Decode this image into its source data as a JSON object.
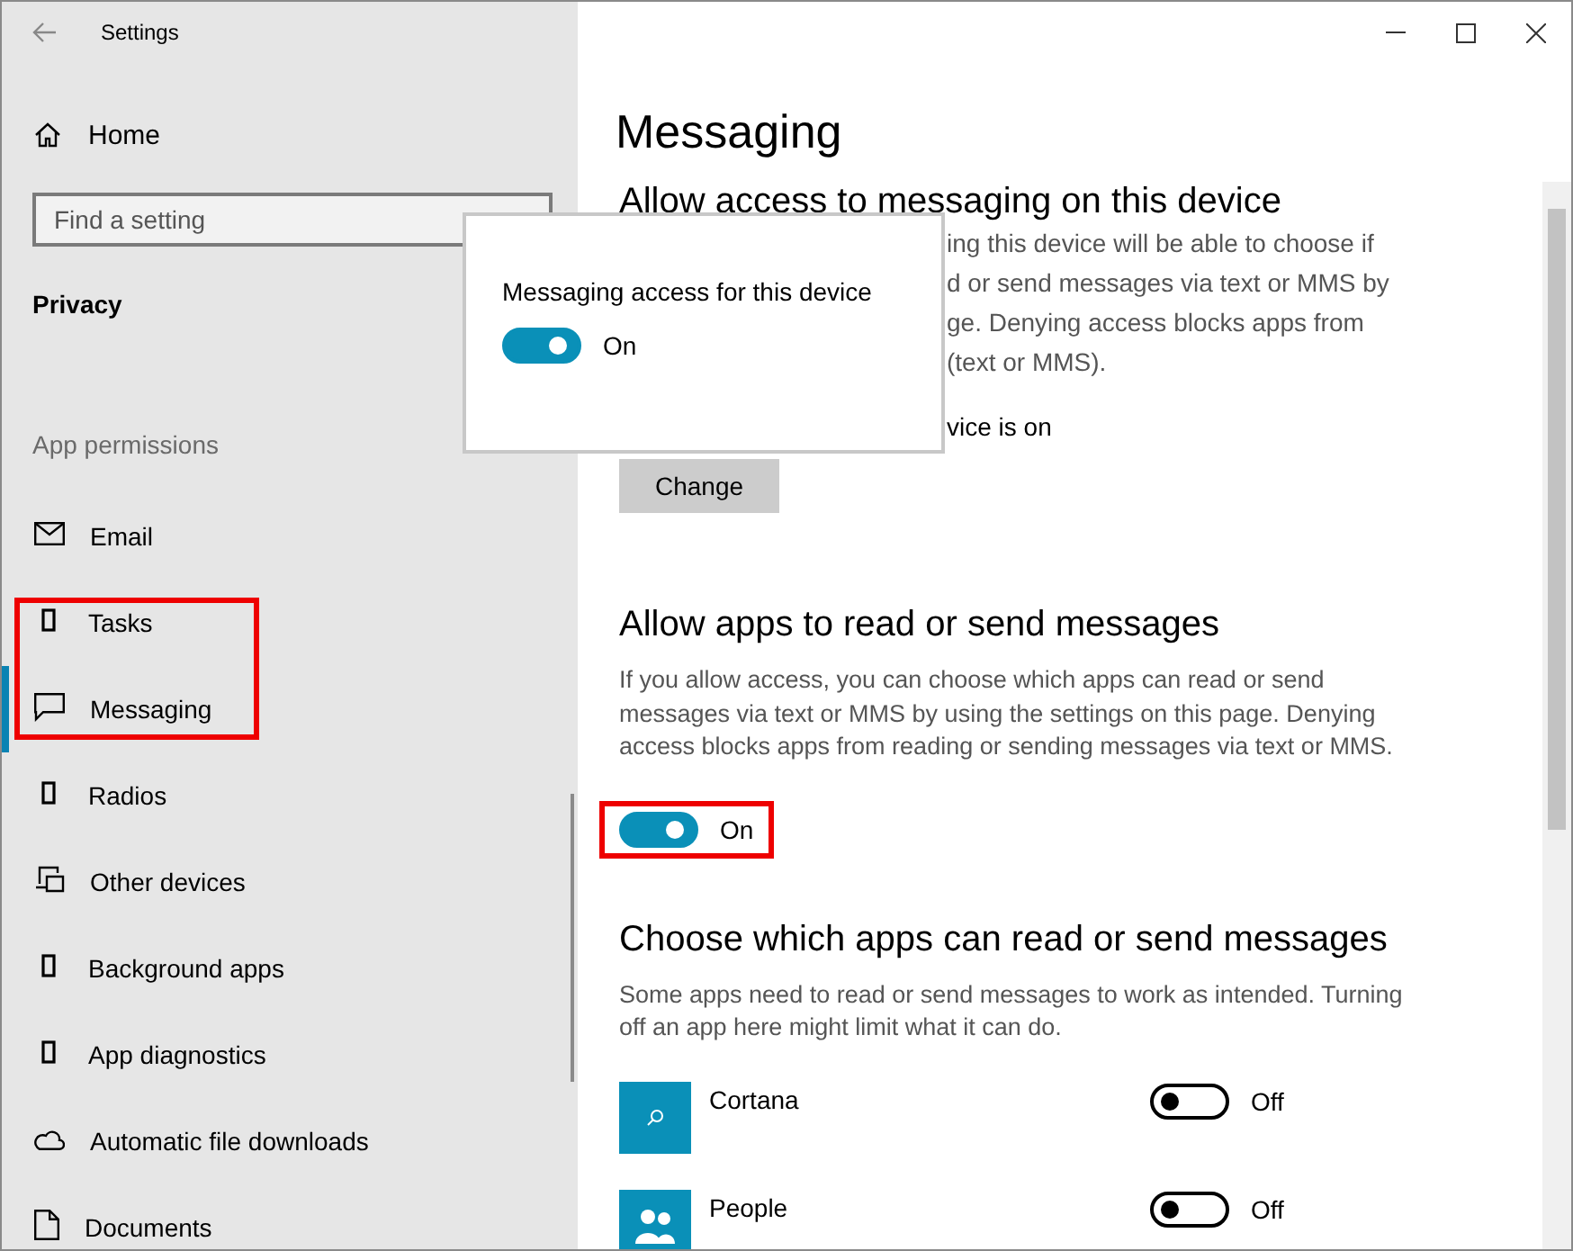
{
  "window": {
    "title": "Settings"
  },
  "sidebar": {
    "home": "Home",
    "search": {
      "placeholder": "Find a setting"
    },
    "section": "Privacy",
    "group": "App permissions",
    "items": [
      {
        "label": "Email",
        "selected": false
      },
      {
        "label": "Tasks",
        "selected": false
      },
      {
        "label": "Messaging",
        "selected": true
      },
      {
        "label": "Radios",
        "selected": false
      },
      {
        "label": "Other devices",
        "selected": false
      },
      {
        "label": "Background apps",
        "selected": false
      },
      {
        "label": "App diagnostics",
        "selected": false
      },
      {
        "label": "Automatic file downloads",
        "selected": false
      },
      {
        "label": "Documents",
        "selected": false
      }
    ]
  },
  "main": {
    "title": "Messaging",
    "device_section": {
      "heading": "Allow access to messaging on this device",
      "text_lines": [
        "ing this device will be able to choose if",
        "d or send messages via text or MMS by",
        "ge. Denying access blocks apps from",
        "(text or MMS)."
      ],
      "status": "vice is on",
      "button": "Change"
    },
    "apps_section": {
      "heading": "Allow apps to read or send messages",
      "text": "If you allow access, you can choose which apps can read or send messages via text or MMS by using the settings on this page. Denying access blocks apps from reading or sending messages via text or MMS.",
      "toggle": {
        "on": true,
        "label": "On"
      }
    },
    "choose_section": {
      "heading": "Choose which apps can read or send messages",
      "text": "Some apps need to read or send messages to work as intended. Turning off an app here might limit what it can do.",
      "apps": [
        {
          "name": "Cortana",
          "on": false,
          "label": "Off"
        },
        {
          "name": "People",
          "on": false,
          "label": "Off"
        }
      ]
    }
  },
  "popup": {
    "title": "Messaging access for this device",
    "toggle": {
      "on": true,
      "label": "On"
    }
  }
}
